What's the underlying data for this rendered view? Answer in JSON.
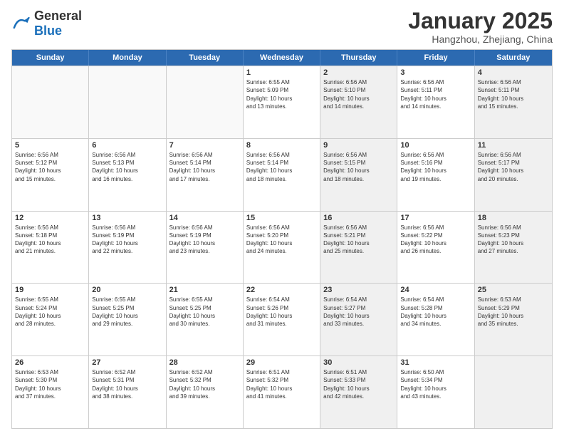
{
  "logo": {
    "general": "General",
    "blue": "Blue"
  },
  "header": {
    "month": "January 2025",
    "location": "Hangzhou, Zhejiang, China"
  },
  "days": [
    "Sunday",
    "Monday",
    "Tuesday",
    "Wednesday",
    "Thursday",
    "Friday",
    "Saturday"
  ],
  "rows": [
    [
      {
        "day": "",
        "info": "",
        "shaded": false,
        "empty": true
      },
      {
        "day": "",
        "info": "",
        "shaded": false,
        "empty": true
      },
      {
        "day": "",
        "info": "",
        "shaded": false,
        "empty": true
      },
      {
        "day": "1",
        "info": "Sunrise: 6:55 AM\nSunset: 5:09 PM\nDaylight: 10 hours\nand 13 minutes.",
        "shaded": false,
        "empty": false
      },
      {
        "day": "2",
        "info": "Sunrise: 6:56 AM\nSunset: 5:10 PM\nDaylight: 10 hours\nand 14 minutes.",
        "shaded": true,
        "empty": false
      },
      {
        "day": "3",
        "info": "Sunrise: 6:56 AM\nSunset: 5:11 PM\nDaylight: 10 hours\nand 14 minutes.",
        "shaded": false,
        "empty": false
      },
      {
        "day": "4",
        "info": "Sunrise: 6:56 AM\nSunset: 5:11 PM\nDaylight: 10 hours\nand 15 minutes.",
        "shaded": true,
        "empty": false
      }
    ],
    [
      {
        "day": "5",
        "info": "Sunrise: 6:56 AM\nSunset: 5:12 PM\nDaylight: 10 hours\nand 15 minutes.",
        "shaded": false,
        "empty": false
      },
      {
        "day": "6",
        "info": "Sunrise: 6:56 AM\nSunset: 5:13 PM\nDaylight: 10 hours\nand 16 minutes.",
        "shaded": false,
        "empty": false
      },
      {
        "day": "7",
        "info": "Sunrise: 6:56 AM\nSunset: 5:14 PM\nDaylight: 10 hours\nand 17 minutes.",
        "shaded": false,
        "empty": false
      },
      {
        "day": "8",
        "info": "Sunrise: 6:56 AM\nSunset: 5:14 PM\nDaylight: 10 hours\nand 18 minutes.",
        "shaded": false,
        "empty": false
      },
      {
        "day": "9",
        "info": "Sunrise: 6:56 AM\nSunset: 5:15 PM\nDaylight: 10 hours\nand 18 minutes.",
        "shaded": true,
        "empty": false
      },
      {
        "day": "10",
        "info": "Sunrise: 6:56 AM\nSunset: 5:16 PM\nDaylight: 10 hours\nand 19 minutes.",
        "shaded": false,
        "empty": false
      },
      {
        "day": "11",
        "info": "Sunrise: 6:56 AM\nSunset: 5:17 PM\nDaylight: 10 hours\nand 20 minutes.",
        "shaded": true,
        "empty": false
      }
    ],
    [
      {
        "day": "12",
        "info": "Sunrise: 6:56 AM\nSunset: 5:18 PM\nDaylight: 10 hours\nand 21 minutes.",
        "shaded": false,
        "empty": false
      },
      {
        "day": "13",
        "info": "Sunrise: 6:56 AM\nSunset: 5:19 PM\nDaylight: 10 hours\nand 22 minutes.",
        "shaded": false,
        "empty": false
      },
      {
        "day": "14",
        "info": "Sunrise: 6:56 AM\nSunset: 5:19 PM\nDaylight: 10 hours\nand 23 minutes.",
        "shaded": false,
        "empty": false
      },
      {
        "day": "15",
        "info": "Sunrise: 6:56 AM\nSunset: 5:20 PM\nDaylight: 10 hours\nand 24 minutes.",
        "shaded": false,
        "empty": false
      },
      {
        "day": "16",
        "info": "Sunrise: 6:56 AM\nSunset: 5:21 PM\nDaylight: 10 hours\nand 25 minutes.",
        "shaded": true,
        "empty": false
      },
      {
        "day": "17",
        "info": "Sunrise: 6:56 AM\nSunset: 5:22 PM\nDaylight: 10 hours\nand 26 minutes.",
        "shaded": false,
        "empty": false
      },
      {
        "day": "18",
        "info": "Sunrise: 6:56 AM\nSunset: 5:23 PM\nDaylight: 10 hours\nand 27 minutes.",
        "shaded": true,
        "empty": false
      }
    ],
    [
      {
        "day": "19",
        "info": "Sunrise: 6:55 AM\nSunset: 5:24 PM\nDaylight: 10 hours\nand 28 minutes.",
        "shaded": false,
        "empty": false
      },
      {
        "day": "20",
        "info": "Sunrise: 6:55 AM\nSunset: 5:25 PM\nDaylight: 10 hours\nand 29 minutes.",
        "shaded": false,
        "empty": false
      },
      {
        "day": "21",
        "info": "Sunrise: 6:55 AM\nSunset: 5:25 PM\nDaylight: 10 hours\nand 30 minutes.",
        "shaded": false,
        "empty": false
      },
      {
        "day": "22",
        "info": "Sunrise: 6:54 AM\nSunset: 5:26 PM\nDaylight: 10 hours\nand 31 minutes.",
        "shaded": false,
        "empty": false
      },
      {
        "day": "23",
        "info": "Sunrise: 6:54 AM\nSunset: 5:27 PM\nDaylight: 10 hours\nand 33 minutes.",
        "shaded": true,
        "empty": false
      },
      {
        "day": "24",
        "info": "Sunrise: 6:54 AM\nSunset: 5:28 PM\nDaylight: 10 hours\nand 34 minutes.",
        "shaded": false,
        "empty": false
      },
      {
        "day": "25",
        "info": "Sunrise: 6:53 AM\nSunset: 5:29 PM\nDaylight: 10 hours\nand 35 minutes.",
        "shaded": true,
        "empty": false
      }
    ],
    [
      {
        "day": "26",
        "info": "Sunrise: 6:53 AM\nSunset: 5:30 PM\nDaylight: 10 hours\nand 37 minutes.",
        "shaded": false,
        "empty": false
      },
      {
        "day": "27",
        "info": "Sunrise: 6:52 AM\nSunset: 5:31 PM\nDaylight: 10 hours\nand 38 minutes.",
        "shaded": false,
        "empty": false
      },
      {
        "day": "28",
        "info": "Sunrise: 6:52 AM\nSunset: 5:32 PM\nDaylight: 10 hours\nand 39 minutes.",
        "shaded": false,
        "empty": false
      },
      {
        "day": "29",
        "info": "Sunrise: 6:51 AM\nSunset: 5:32 PM\nDaylight: 10 hours\nand 41 minutes.",
        "shaded": false,
        "empty": false
      },
      {
        "day": "30",
        "info": "Sunrise: 6:51 AM\nSunset: 5:33 PM\nDaylight: 10 hours\nand 42 minutes.",
        "shaded": true,
        "empty": false
      },
      {
        "day": "31",
        "info": "Sunrise: 6:50 AM\nSunset: 5:34 PM\nDaylight: 10 hours\nand 43 minutes.",
        "shaded": false,
        "empty": false
      },
      {
        "day": "",
        "info": "",
        "shaded": true,
        "empty": true
      }
    ]
  ]
}
